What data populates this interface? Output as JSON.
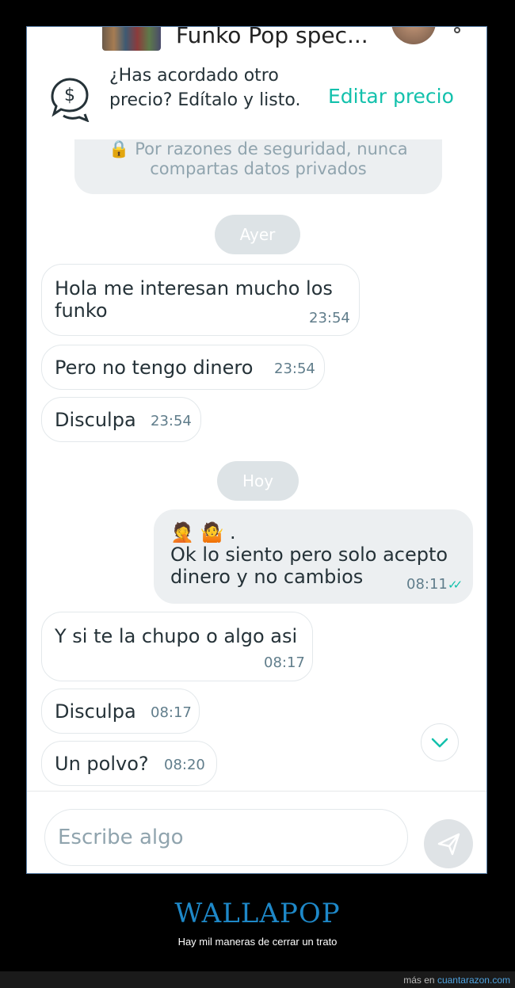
{
  "header": {
    "title": "Funko Pop spec...",
    "thumbnail_icon": "product-thumbnail",
    "avatar_icon": "user-avatar",
    "menu_icon": "more-options-icon"
  },
  "price_banner": {
    "icon": "price-chat-icon",
    "text": "¿Has acordado otro precio? Edítalo y listo.",
    "action": "Editar precio"
  },
  "security_notice": {
    "icon": "🔒",
    "text": "Por razones de seguridad, nunca compartas datos privados"
  },
  "separators": {
    "yesterday": "Ayer",
    "today": "Hoy"
  },
  "messages": [
    {
      "text": "Hola me interesan mucho los funko",
      "time": "23:54",
      "mine": false
    },
    {
      "text": "Pero no tengo dinero",
      "time": "23:54",
      "mine": false
    },
    {
      "text": "Disculpa",
      "time": "23:54",
      "mine": false
    },
    {
      "text": "🤦 🤷 .\nOk lo siento pero solo acepto dinero y no cambios",
      "time": "08:11",
      "mine": true,
      "status": "read"
    },
    {
      "text": "Y si te la chupo o algo asi",
      "time": "08:17",
      "mine": false
    },
    {
      "text": "Disculpa",
      "time": "08:17",
      "mine": false
    },
    {
      "text": "Un polvo?",
      "time": "08:20",
      "mine": false
    }
  ],
  "input": {
    "placeholder": "Escribe algo",
    "send_icon": "send-icon",
    "scroll_icon": "chevron-down-icon"
  },
  "footer": {
    "brand": "WALLAPOP",
    "caption": "Hay mil maneras de cerrar un trato",
    "source_prefix": "más en",
    "source_link": "cuantarazon.com"
  },
  "colors": {
    "accent": "#13c1ac",
    "bubble_mine": "#eceff1",
    "brand_blue": "#1e88c8"
  }
}
